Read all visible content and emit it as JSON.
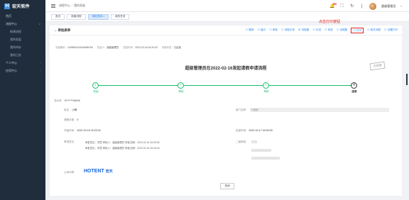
{
  "app": {
    "logo_text": "宏天软件",
    "logo_mark": "H"
  },
  "sidebar": {
    "items": [
      {
        "label": "首页",
        "arrow": ""
      },
      {
        "label": "流程中心",
        "arrow": "∨"
      },
      {
        "label": "新建流程",
        "arrow": ""
      },
      {
        "label": "我的发起",
        "arrow": ""
      },
      {
        "label": "我的待办",
        "arrow": ""
      },
      {
        "label": "我的已办",
        "arrow": ""
      },
      {
        "label": "个人中心",
        "arrow": "›"
      },
      {
        "label": "应用中心",
        "arrow": "›"
      }
    ]
  },
  "header": {
    "breadcrumb": [
      "流程中心",
      "我的发起"
    ],
    "badge": "10",
    "user_name": "超级管理员"
  },
  "tabs": [
    {
      "label": "首页"
    },
    {
      "label": "新建流程"
    },
    {
      "label": "审批表单 ×"
    },
    {
      "label": "我的任务"
    }
  ],
  "panel": {
    "back_label": "← 审批表单",
    "actions": [
      "⊙ 撤销",
      "⊙ 催办",
      "⊙ 审批",
      "⊙ 流程记录",
      "⊕ 流程图",
      "⊙ 抄送",
      "⊙ 转发",
      "⊙ 流程图",
      "⊙ 打印",
      "⊙ 相关流程",
      "⊙ 设置打印"
    ],
    "print_hint": "点击打印按钮",
    "meta": [
      {
        "key": "流程编号：",
        "value": "1493694216164958760"
      },
      {
        "key": "发起人：",
        "value": "超级管理员"
      },
      {
        "key": "发起时间：",
        "value": "2022-02-16 16:20:43"
      },
      {
        "key": "流程状态：",
        "value": "已结束"
      }
    ],
    "stamp": "已结束",
    "title": "超级管理员在2022-02-16发起请假申请流程",
    "steps": [
      {
        "icon": "✓",
        "label": "发起"
      },
      {
        "icon": "✓",
        "label": "审批"
      },
      {
        "icon": "✓",
        "label": "审批"
      },
      {
        "icon": "4",
        "label": "结束"
      }
    ],
    "fields": {
      "no_label": "流水号",
      "no_value": "XY*****00104",
      "name_label": "姓名",
      "name_value": "小明",
      "dept_label": "部门名称",
      "dept_value": "行政部",
      "days_label": "请假天数",
      "days_value": "0",
      "start_label": "开始时间",
      "start_value": "2022-02-16 16:20:02",
      "end_label": "结束时间",
      "end_value": "2022-02-17 00:00:00",
      "opinion_label": "审批意见",
      "sign_label": "二级审批",
      "logo_label": "公司印章"
    },
    "approvals": [
      "审批意见：同意 审批人：超级管理员 审批日期：2022-02-16 16:25:36",
      "审批意见：同意 审批人：超级管理员 审批日期：2022-02-16 16:25:43"
    ],
    "sign_logo": {
      "en": "HOTENT",
      "cn": "宏天"
    },
    "close_label": "关闭"
  }
}
